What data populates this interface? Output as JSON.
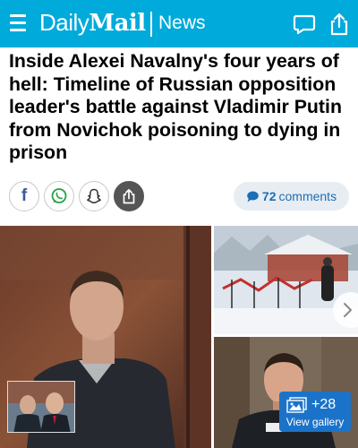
{
  "header": {
    "brand_daily": "Daily",
    "brand_mail": "Mail",
    "section": "News",
    "background_color": "#00aadb",
    "icons": [
      "menu-icon",
      "comment-icon",
      "share-icon"
    ]
  },
  "article": {
    "headline": "Inside Alexei Navalny's four years of hell: Timeline of Russian opposition leader's battle against Vladimir Putin from Novichok poisoning to dying in prison"
  },
  "social": {
    "buttons": [
      "facebook-icon",
      "whatsapp-icon",
      "snapchat-icon",
      "share-icon"
    ],
    "comments_count": "72",
    "comments_label": "comments",
    "comments_color": "#1a6fb5"
  },
  "gallery": {
    "more_count": "+28",
    "view_label": "View gallery",
    "button_color": "#1b73c9"
  }
}
